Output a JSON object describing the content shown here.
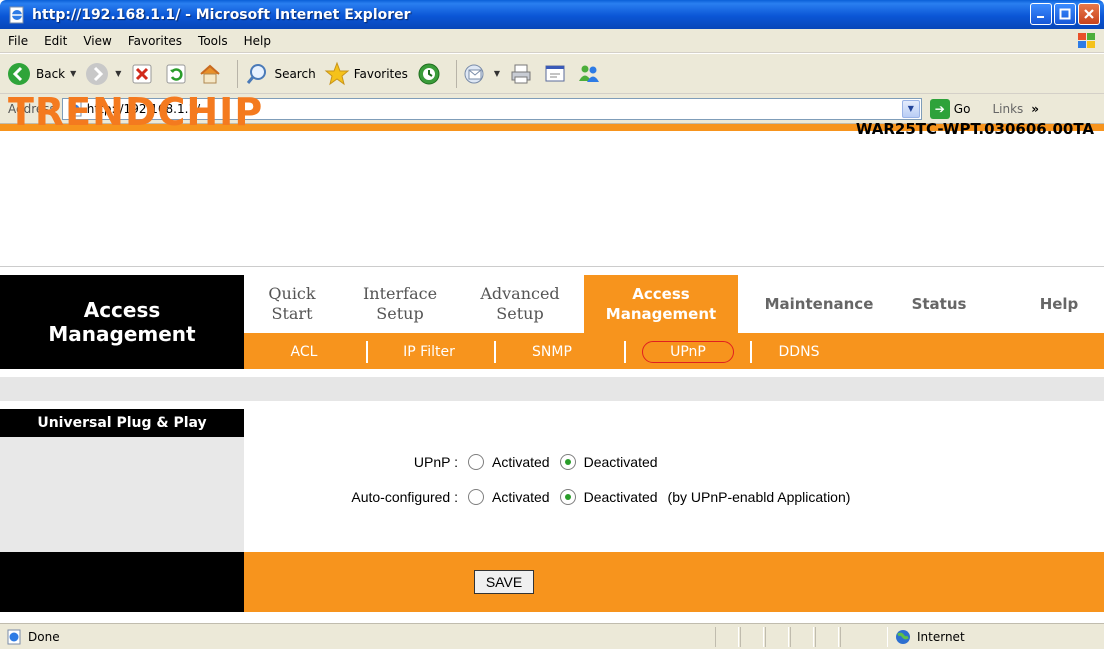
{
  "window": {
    "title": "http://192.168.1.1/ - Microsoft Internet Explorer"
  },
  "menubar": {
    "items": [
      "File",
      "Edit",
      "View",
      "Favorites",
      "Tools",
      "Help"
    ]
  },
  "toolbar": {
    "back_label": "Back",
    "search_label": "Search",
    "favorites_label": "Favorites"
  },
  "addressbar": {
    "label": "Address",
    "url": "http://192.168.1.1/",
    "go_label": "Go",
    "links_label": "Links"
  },
  "router": {
    "logo": "TRENDCHIP",
    "model": "WAR25TC-WPT.030606.00TA",
    "section_title_line1": "Access",
    "section_title_line2": "Management",
    "nav": [
      {
        "line1": "Quick",
        "line2": "Start"
      },
      {
        "line1": "Interface",
        "line2": "Setup"
      },
      {
        "line1": "Advanced",
        "line2": "Setup"
      },
      {
        "line1": "Access",
        "line2": "Management"
      },
      {
        "line1": "Maintenance",
        "line2": ""
      },
      {
        "line1": "Status",
        "line2": ""
      },
      {
        "line1": "Help",
        "line2": ""
      }
    ],
    "subnav": [
      "ACL",
      "IP Filter",
      "SNMP",
      "UPnP",
      "DDNS"
    ],
    "panel_title": "Universal Plug & Play",
    "form": {
      "upnp_label": "UPnP :",
      "auto_label": "Auto-configured :",
      "activated": "Activated",
      "deactivated": "Deactivated",
      "auto_note": "(by UPnP-enabld Application)",
      "upnp_value": "Deactivated",
      "auto_value": "Deactivated"
    },
    "save_label": "SAVE"
  },
  "statusbar": {
    "status": "Done",
    "zone": "Internet"
  },
  "colors": {
    "accent": "#f7941d",
    "logo": "#f47a1f"
  }
}
